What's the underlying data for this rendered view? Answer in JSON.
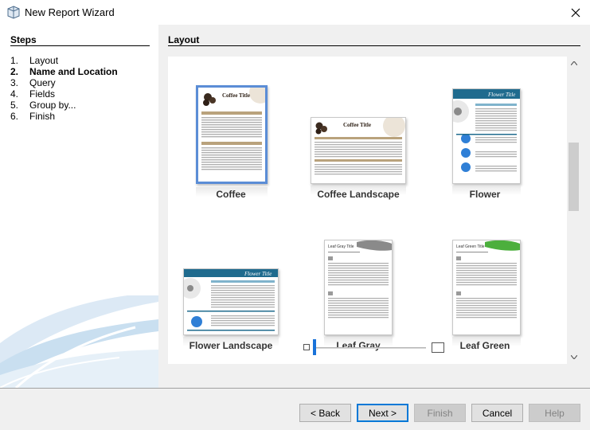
{
  "window": {
    "title": "New Report Wizard",
    "icon": "report-wizard-icon"
  },
  "steps": {
    "heading": "Steps",
    "items": [
      {
        "num": "1.",
        "label": "Layout",
        "current": false
      },
      {
        "num": "2.",
        "label": "Name and Location",
        "current": true
      },
      {
        "num": "3.",
        "label": "Query",
        "current": false
      },
      {
        "num": "4.",
        "label": "Fields",
        "current": false
      },
      {
        "num": "5.",
        "label": "Group by...",
        "current": false
      },
      {
        "num": "6.",
        "label": "Finish",
        "current": false
      }
    ]
  },
  "layout": {
    "heading": "Layout",
    "templates": [
      {
        "label": "Coffee",
        "selected": true,
        "thumb_title": "Coffee Title"
      },
      {
        "label": "Coffee Landscape",
        "selected": false,
        "thumb_title": "Coffee Title"
      },
      {
        "label": "Flower",
        "selected": false,
        "thumb_title": "Flower Title"
      },
      {
        "label": "Flower Landscape",
        "selected": false,
        "thumb_title": "Flower Title"
      },
      {
        "label": "Leaf Gray",
        "selected": false,
        "thumb_title": "Leaf Gray Title"
      },
      {
        "label": "Leaf Green",
        "selected": false,
        "thumb_title": "Leaf Green Title"
      }
    ],
    "zoom_level": 0
  },
  "buttons": {
    "back": "< Back",
    "next": "Next >",
    "finish": "Finish",
    "cancel": "Cancel",
    "help": "Help"
  },
  "colors": {
    "accent": "#0078d7",
    "selection": "#5b8dd6",
    "flower_blue": "#1f6b8e"
  }
}
